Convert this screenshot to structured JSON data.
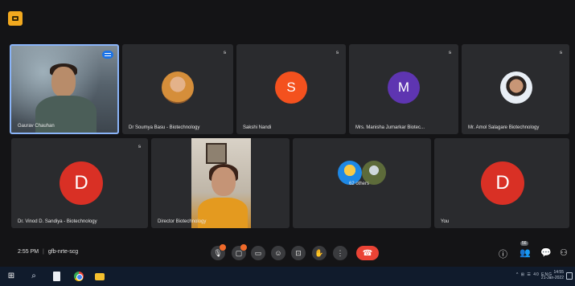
{
  "colors": {
    "avatar_red": "#d93025",
    "avatar_orange": "#f4511e",
    "avatar_purple": "#5e35b1",
    "tile_bg": "#2a2b2e",
    "end_call": "#ea4335",
    "pin_blue": "#1a73e8"
  },
  "participants": [
    {
      "name": "Gaurav Chauhan",
      "type": "video"
    },
    {
      "name": "Dr Soumya Basu - Biotechnology",
      "type": "photo"
    },
    {
      "name": "Sakshi Nandi",
      "type": "letter",
      "letter": "S"
    },
    {
      "name": "Mrs. Manisha Jumarkar Biotec...",
      "type": "letter",
      "letter": "M"
    },
    {
      "name": "Mr. Amol Salagare Biotechnology",
      "type": "photo"
    },
    {
      "name": "Dr. Vinod D. Sandiya - Biotechnology",
      "type": "letter",
      "letter": "D"
    },
    {
      "name": "Director Biotechnology",
      "type": "video"
    },
    {
      "name": "62 others",
      "type": "group"
    },
    {
      "name": "You",
      "type": "letter",
      "letter": "D"
    }
  ],
  "meeting": {
    "time": "2:55 PM",
    "code": "gfb-nrte-scg"
  },
  "icons": {
    "mic": "mic-off-icon",
    "camera": "camera-off-icon",
    "captions": "captions-icon",
    "emoji": "emoji-icon",
    "present": "present-icon",
    "hand": "raise-hand-icon",
    "more": "more-options-icon",
    "end": "end-call-icon",
    "info": "info-icon",
    "people": "people-icon",
    "chat": "chat-icon",
    "activities": "activities-icon"
  },
  "controls": {
    "people_count": "56"
  },
  "taskbar": {
    "tray": "^ ⊞ ☰ 40 ENG",
    "time": "14:55",
    "date": "21-Jan-2022"
  }
}
